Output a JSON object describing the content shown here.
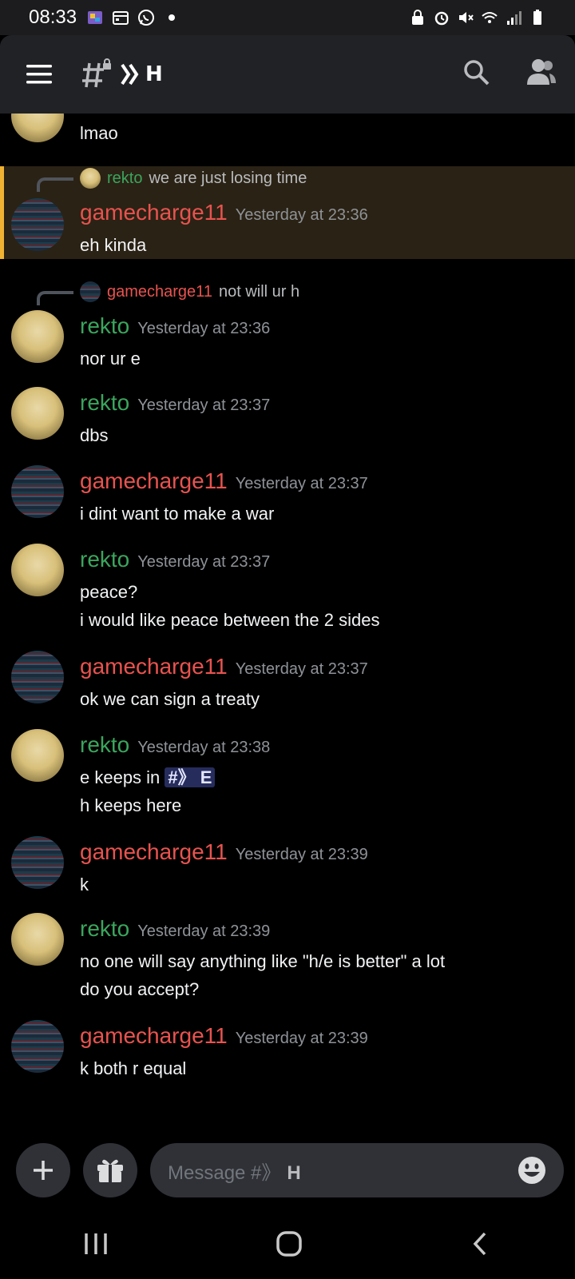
{
  "status_bar": {
    "time": "08:33"
  },
  "header": {
    "channel_name": "H"
  },
  "messages": [
    {
      "text": "lmao"
    },
    {
      "reply_to": {
        "author": "rekto",
        "text": "we are just losing time"
      },
      "author": "gamecharge11",
      "timestamp": "Yesterday at 23:36",
      "lines": [
        "eh kinda"
      ]
    },
    {
      "reply_to": {
        "author": "gamecharge11",
        "text": "not will ur h"
      },
      "author": "rekto",
      "timestamp": "Yesterday at 23:36",
      "lines": [
        "nor ur e"
      ]
    },
    {
      "author": "rekto",
      "timestamp": "Yesterday at 23:37",
      "lines": [
        "dbs"
      ]
    },
    {
      "author": "gamecharge11",
      "timestamp": "Yesterday at 23:37",
      "lines": [
        "i dint want to make a war"
      ]
    },
    {
      "author": "rekto",
      "timestamp": "Yesterday at 23:37",
      "lines": [
        "peace?",
        "i would like peace between the 2 sides"
      ]
    },
    {
      "author": "gamecharge11",
      "timestamp": "Yesterday at 23:37",
      "lines": [
        "ok we can sign a treaty"
      ]
    },
    {
      "author": "rekto",
      "timestamp": "Yesterday at 23:38",
      "lines": [
        "e keeps in",
        "h keeps here"
      ],
      "mention": "#》 E"
    },
    {
      "author": "gamecharge11",
      "timestamp": "Yesterday at 23:39",
      "lines": [
        "k"
      ]
    },
    {
      "author": "rekto",
      "timestamp": "Yesterday at 23:39",
      "lines": [
        "no one will say anything like \"h/e is better\" a lot",
        "do you accept?"
      ]
    },
    {
      "author": "gamecharge11",
      "timestamp": "Yesterday at 23:39",
      "lines": [
        "k both r equal"
      ]
    }
  ],
  "composer": {
    "placeholder_prefix": "Message #》",
    "placeholder_channel": "H"
  },
  "colors": {
    "rekto": "#3ba55d",
    "gamecharge11": "#e8534f",
    "reply_highlight": "#f0b232"
  }
}
